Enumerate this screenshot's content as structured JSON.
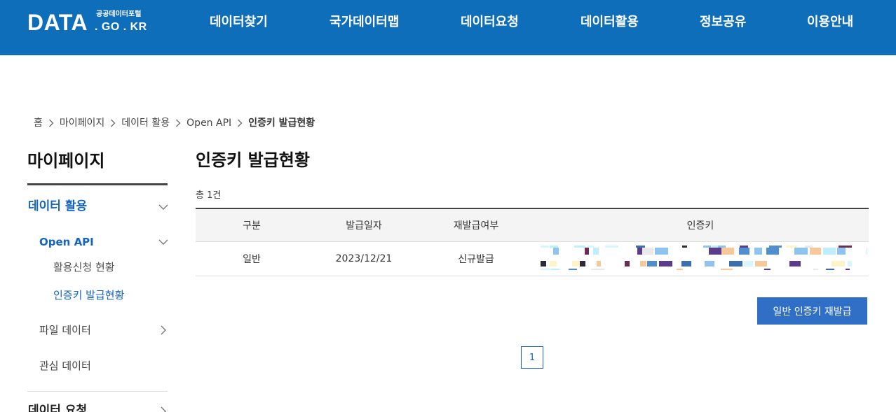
{
  "header": {
    "logo_main": "DATA",
    "logo_sub_top": "공공데이터포털",
    "logo_sub_bottom": ". GO . KR",
    "nav": [
      "데이터찾기",
      "국가데이터맵",
      "데이터요청",
      "데이터활용",
      "정보공유",
      "이용안내"
    ],
    "bg_color": "#0f6eb9"
  },
  "breadcrumb": [
    "홈",
    "마이페이지",
    "데이터 활용",
    "Open API",
    "인증키 발급현황"
  ],
  "sidebar": {
    "title": "마이페이지",
    "section_active": "데이터 활용",
    "sub_active": "Open API",
    "sub_items": [
      "활용신청 현황",
      "인증키 발급현황"
    ],
    "file_data": "파일 데이터",
    "interest_data": "관심 데이터",
    "next_section": "데이터 요청"
  },
  "main": {
    "title": "인증키 발급현황",
    "total": "총 1건",
    "table": {
      "headers": [
        "구분",
        "발급일자",
        "재발급여부",
        "인증키"
      ],
      "rows": [
        {
          "type": "일반",
          "date": "2023/12/21",
          "reissue": "신규발급",
          "key": ""
        }
      ]
    },
    "reissue_button": "일반 인증키 재발급",
    "pagination": {
      "current": "1"
    }
  },
  "colors": {
    "accent": "#1565c0",
    "button": "#2f6fc6"
  },
  "icons": {
    "breadcrumb_separator": "chevron-right-icon",
    "expand": "chevron-down-icon",
    "collapse": "chevron-right-icon"
  }
}
